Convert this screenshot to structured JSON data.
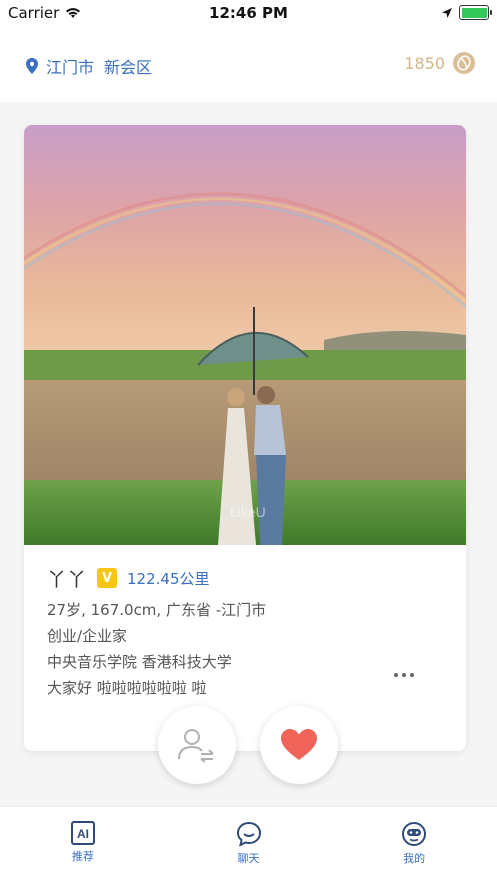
{
  "status_bar": {
    "carrier": "Carrier",
    "time": "12:46 PM"
  },
  "header": {
    "location_icon": "location-pin-icon",
    "city": "江门市",
    "district": "新会区",
    "coins": "1850",
    "coin_icon": "coffee-bean-icon"
  },
  "profile": {
    "photo": "couple-under-umbrella-rainbow-photo",
    "watermark": "LikeU",
    "name": "丫丫",
    "vip_badge": "V",
    "distance": "122.45公里",
    "basic": "27岁, 167.0cm, 广东省 -江门市",
    "occupation": "创业/企业家",
    "schools": "中央音乐学院 香港科技大学",
    "bio": "大家好 啦啦啦啦啦啦 啦"
  },
  "actions": {
    "skip_icon": "person-switch-icon",
    "like_icon": "heart-icon"
  },
  "tabs": [
    {
      "label": "推荐",
      "icon": "ai-recommend-icon"
    },
    {
      "label": "聊天",
      "icon": "chat-bubble-icon"
    },
    {
      "label": "我的",
      "icon": "profile-face-icon"
    }
  ],
  "colors": {
    "accent": "#3a6fc1",
    "like": "#f0645a",
    "coin": "#d3b58a",
    "vip": "#f5c518"
  }
}
